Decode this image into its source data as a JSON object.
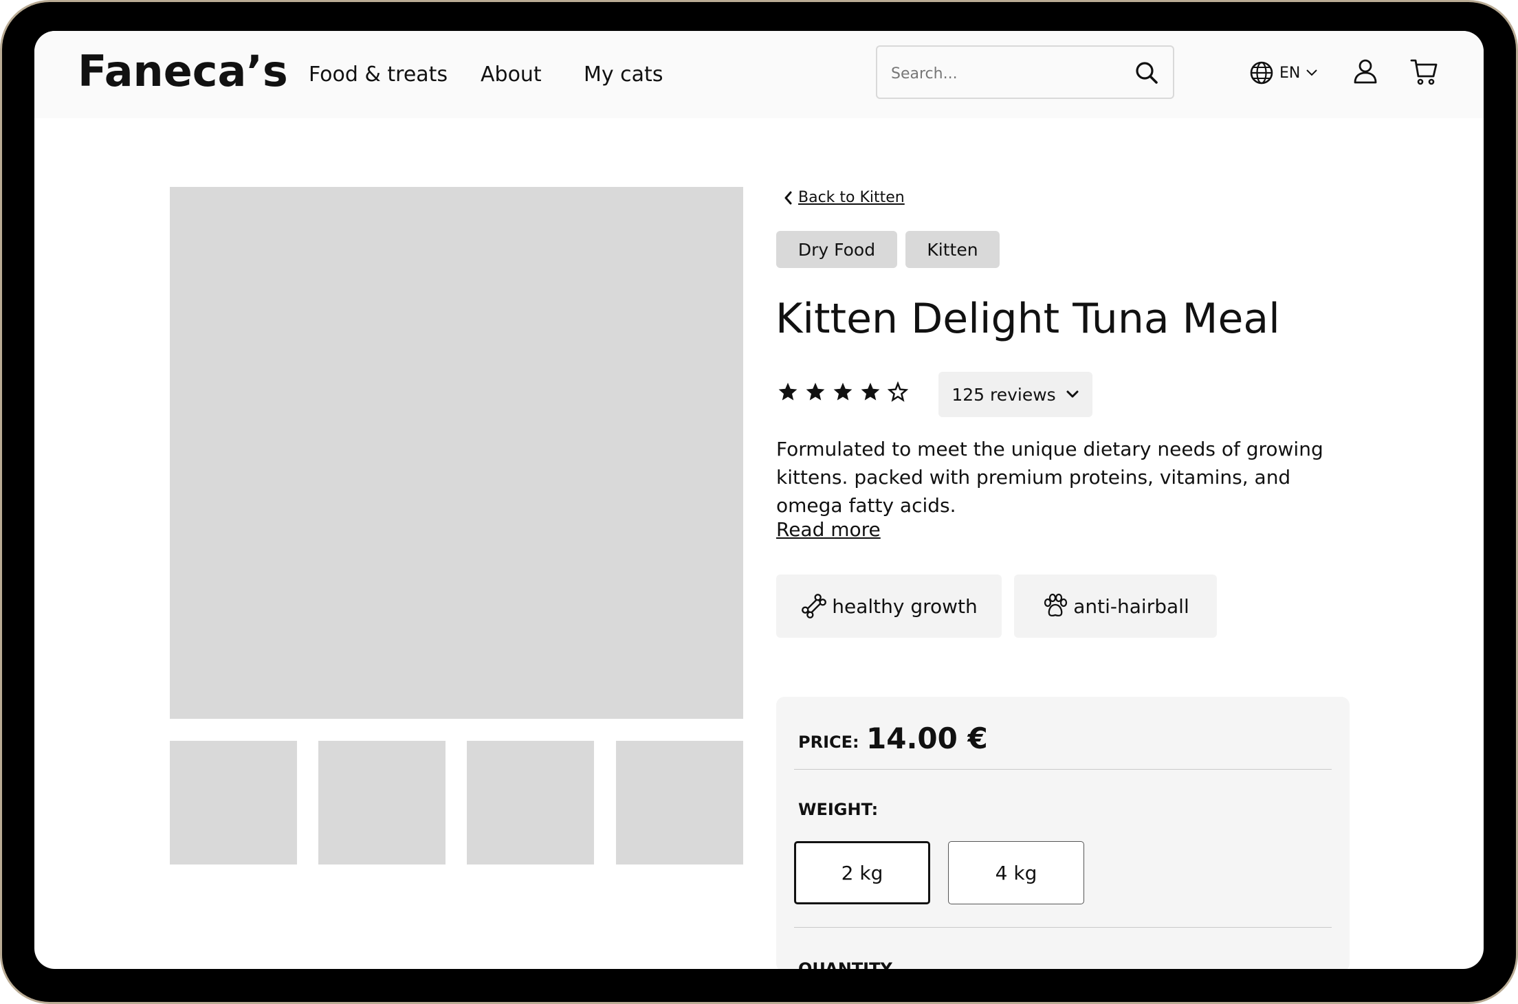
{
  "header": {
    "logo": "Faneca’s",
    "nav": [
      {
        "label": "Food & treats"
      },
      {
        "label": "About"
      },
      {
        "label": "My cats"
      }
    ],
    "search": {
      "placeholder": "Search...",
      "value": ""
    },
    "language": {
      "code": "EN",
      "icon": "globe-icon"
    },
    "icons": {
      "account": "user-icon",
      "cart": "cart-icon",
      "search": "search-icon"
    }
  },
  "gallery": {
    "thumbnail_count": 4
  },
  "product": {
    "back_link": "Back to Kitten",
    "tags": [
      "Dry Food",
      "Kitten"
    ],
    "title": "Kitten Delight Tuna Meal",
    "rating": 4,
    "rating_max": 5,
    "reviews_label": "125 reviews",
    "description": "Formulated to meet the unique dietary needs of growing kittens. packed with premium proteins, vitamins, and omega fatty acids.",
    "read_more": "Read more",
    "benefits": [
      {
        "label": "healthy growth",
        "icon": "bone-icon"
      },
      {
        "label": "anti-hairball",
        "icon": "paw-icon"
      }
    ]
  },
  "purchase": {
    "price_label": "PRICE:",
    "price_value": "14.00 €",
    "weight_label": "WEIGHT:",
    "weights": [
      {
        "label": "2 kg",
        "selected": true
      },
      {
        "label": "4 kg",
        "selected": false
      }
    ],
    "quantity_label": "QUANTITY"
  },
  "colors": {
    "device_frame": "#b9ab94",
    "bezel": "#000000",
    "placeholder_gray": "#d9d9d9",
    "panel_gray": "#f5f5f5",
    "text": "#111111"
  }
}
